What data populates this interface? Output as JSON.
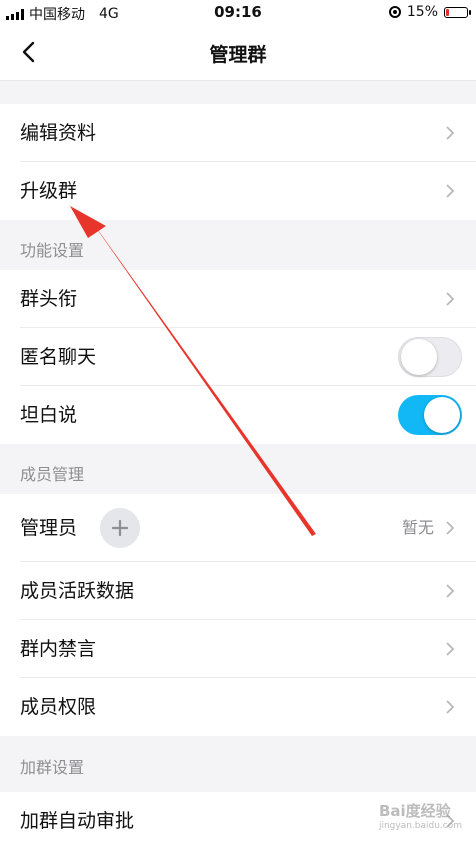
{
  "status_bar": {
    "carrier": "中国移动",
    "network": "4G",
    "time": "09:16",
    "battery": "15%",
    "battery_level": 0.15
  },
  "header": {
    "title": "管理群"
  },
  "group_basic": {
    "items": [
      {
        "label": "编辑资料"
      },
      {
        "label": "升级群"
      }
    ]
  },
  "features": {
    "header": "功能设置",
    "items": [
      {
        "label": "群头衔"
      },
      {
        "label": "匿名聊天",
        "enabled": false
      },
      {
        "label": "坦白说",
        "enabled": true
      }
    ]
  },
  "members": {
    "header": "成员管理",
    "admin": {
      "label": "管理员",
      "value": "暂无"
    },
    "items": [
      {
        "label": "成员活跃数据"
      },
      {
        "label": "群内禁言"
      },
      {
        "label": "成员权限"
      }
    ]
  },
  "join": {
    "header": "加群设置",
    "items": [
      {
        "label": "加群自动审批"
      }
    ]
  },
  "watermark": {
    "brand": "Bai度经验",
    "url": "jingyan.baidu.com"
  },
  "colors": {
    "toggle_on": "#12b7f5",
    "annotation_arrow": "#e8352b",
    "battery_low": "#e53030"
  }
}
